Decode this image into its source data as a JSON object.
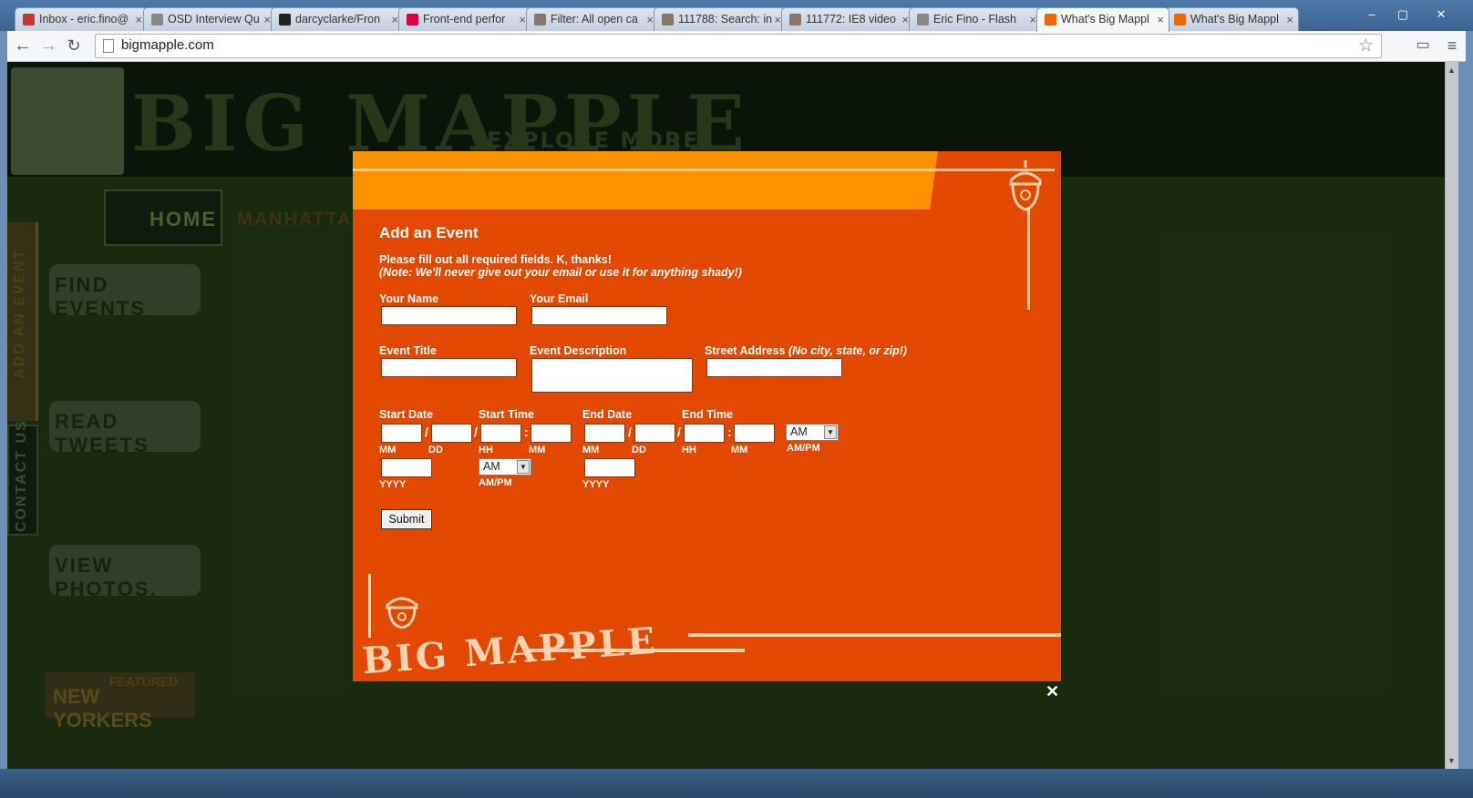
{
  "browser": {
    "tabs": [
      {
        "label": "Inbox - eric.fino@",
        "favicon": "gmail-icon",
        "fav_color": "#c33"
      },
      {
        "label": "OSD Interview Qu",
        "favicon": "doc-icon",
        "fav_color": "#888"
      },
      {
        "label": "darcyclarke/Fron",
        "favicon": "github-icon",
        "fav_color": "#222"
      },
      {
        "label": "Front-end perfor",
        "favicon": "slides-icon",
        "fav_color": "#d04"
      },
      {
        "label": "Filter: All open ca",
        "favicon": "bug-icon",
        "fav_color": "#876"
      },
      {
        "label": "111788: Search: in",
        "favicon": "bug-icon",
        "fav_color": "#876"
      },
      {
        "label": "111772: IE8 video",
        "favicon": "bug-icon",
        "fav_color": "#876"
      },
      {
        "label": "Eric Fino - Flash",
        "favicon": "doc-icon",
        "fav_color": "#888"
      },
      {
        "label": "What's Big Mappl",
        "favicon": "acorn-icon",
        "fav_color": "#e60"
      },
      {
        "label": "What's Big Mappl",
        "favicon": "acorn-icon",
        "fav_color": "#e60"
      }
    ],
    "active_tab": 8,
    "url": "bigmapple.com",
    "window_controls": {
      "min": "–",
      "max": "▢",
      "close": "✕"
    }
  },
  "site": {
    "logo_text": "BIG MAPPLE",
    "tagline": "EXPLORE MORE",
    "nav_home": "HOME",
    "nav_manhattan": "MANHATTAN",
    "find_events": "FIND EVENTS",
    "read_tweets": "READ TWEETS",
    "view_photos": "VIEW PHOTOS.",
    "side_add_event": "ADD AN EVENT",
    "side_contact": "CONTACT US",
    "featured": "FEATURED",
    "new_yorkers": "NEW YORKERS"
  },
  "modal": {
    "title": "Add an Event",
    "intro_line1": "Please fill out all required fields. K, thanks!",
    "intro_line2": "(Note: We'll never give out your email or use it for anything shady!)",
    "labels": {
      "name": "Your Name",
      "email": "Your Email",
      "event_title": "Event Title",
      "event_description": "Event Description",
      "street_address": "Street Address",
      "street_address_note": "(No city, state, or zip!)",
      "start_date": "Start Date",
      "start_time": "Start Time",
      "end_date": "End Date",
      "end_time": "End Time"
    },
    "sub": {
      "mm": "MM",
      "dd": "DD",
      "yyyy": "YYYY",
      "hh": "HH",
      "ampm": "AM/PM"
    },
    "values": {
      "name": "",
      "email": "",
      "event_title": "",
      "event_description": "",
      "street_address": "",
      "start_ampm": "AM",
      "end_ampm": "AM"
    },
    "submit_label": "Submit",
    "footer_logo": "BIG MAPPLE",
    "close_glyph": "✕"
  }
}
